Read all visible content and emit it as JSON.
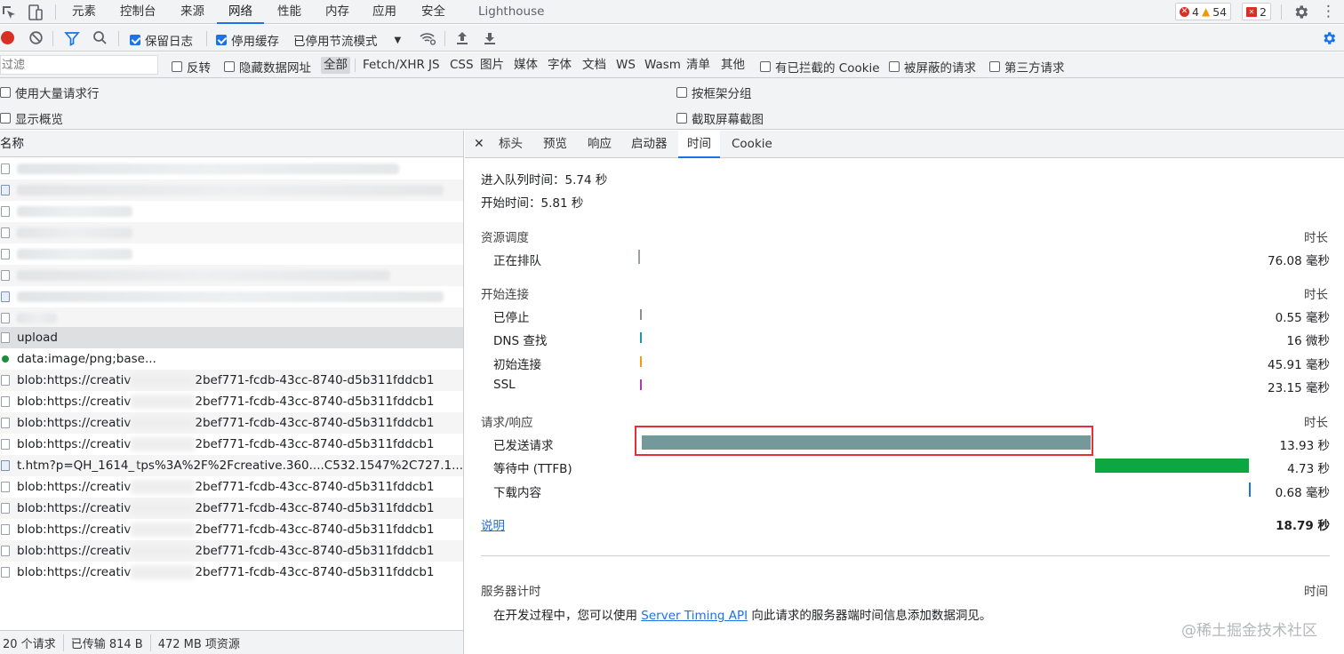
{
  "top_tabs": [
    "元素",
    "控制台",
    "来源",
    "网络",
    "性能",
    "内存",
    "应用",
    "安全",
    "Lighthouse"
  ],
  "active_tab": "网络",
  "badges": {
    "errors": "4",
    "warnings": "54",
    "issues": "2"
  },
  "toolbar": {
    "preserve_log": "保留日志",
    "disable_cache": "停用缓存",
    "throttle": "已停用节流模式"
  },
  "filter": {
    "placeholder": "过滤",
    "invert": "反转",
    "hide_data_urls": "隐藏数据网址",
    "types": [
      "全部",
      "Fetch/XHR",
      "JS",
      "CSS",
      "图片",
      "媒体",
      "字体",
      "文档",
      "WS",
      "Wasm",
      "清单",
      "其他"
    ],
    "selected_type": "全部",
    "blocked_cookies": "有已拦截的 Cookie",
    "blocked_requests": "被屏蔽的请求",
    "third_party": "第三方请求"
  },
  "options": {
    "large_rows": "使用大量请求行",
    "group_by_frame": "按框架分组",
    "show_overview": "显示概览",
    "capture_screenshots": "截取屏幕截图"
  },
  "list": {
    "header": "名称",
    "rows": [
      {
        "name": "upload",
        "selected": true
      },
      {
        "name": "data:image/png;base..."
      },
      {
        "name_start": "blob:https://creativ",
        "name_end": "2bef771-fcdb-43cc-8740-d5b311fddcb1"
      },
      {
        "name_start": "blob:https://creativ",
        "name_end": "2bef771-fcdb-43cc-8740-d5b311fddcb1"
      },
      {
        "name_start": "blob:https://creativ",
        "name_end": "2bef771-fcdb-43cc-8740-d5b311fddcb1"
      },
      {
        "name_start": "blob:https://creativ",
        "name_end": "2bef771-fcdb-43cc-8740-d5b311fddcb1"
      },
      {
        "name_start": "t.htm?p=QH_1614_",
        "name_end": "tps%3A%2F%2Fcreative.360....C532.1547%2C727.1..."
      },
      {
        "name_start": "blob:https://creativ",
        "name_end": "2bef771-fcdb-43cc-8740-d5b311fddcb1"
      },
      {
        "name_start": "blob:https://creativ",
        "name_end": "2bef771-fcdb-43cc-8740-d5b311fddcb1"
      },
      {
        "name_start": "blob:https://creativ",
        "name_end": "2bef771-fcdb-43cc-8740-d5b311fddcb1"
      },
      {
        "name_start": "blob:https://creativ",
        "name_end": "2bef771-fcdb-43cc-8740-d5b311fddcb1"
      },
      {
        "name_start": "blob:https://creativ",
        "name_end": "2bef771-fcdb-43cc-8740-d5b311fddcb1"
      }
    ]
  },
  "status": {
    "requests": "20 个请求",
    "transferred": "已传输 814 B",
    "resources": "472 MB 项资源"
  },
  "detail_tabs": [
    "标头",
    "预览",
    "响应",
    "启动器",
    "时间",
    "Cookie"
  ],
  "active_detail_tab": "时间",
  "timing": {
    "queued_at": "进入队列时间：5.74 秒",
    "started_at": "开始时间：5.81 秒",
    "duration_header": "时长",
    "sections": {
      "scheduling": {
        "title": "资源调度",
        "rows": [
          {
            "label": "正在排队",
            "value": "76.08 毫秒"
          }
        ]
      },
      "connection": {
        "title": "开始连接",
        "rows": [
          {
            "label": "已停止",
            "value": "0.55 毫秒"
          },
          {
            "label": "DNS 查找",
            "value": "16 微秒"
          },
          {
            "label": "初始连接",
            "value": "45.91 毫秒"
          },
          {
            "label": "SSL",
            "value": "23.15 毫秒"
          }
        ]
      },
      "request": {
        "title": "请求/响应",
        "rows": [
          {
            "label": "已发送请求",
            "value": "13.93 秒"
          },
          {
            "label": "等待中 (TTFB)",
            "value": "4.73 秒"
          },
          {
            "label": "下载内容",
            "value": "0.68 毫秒"
          }
        ]
      }
    },
    "explanation": "说明",
    "total": "18.79 秒",
    "server_timing": {
      "title": "服务器计时",
      "time_header": "时间",
      "text_before": "在开发过程中，您可以使用 ",
      "link": "Server Timing API",
      "text_after": " 向此请求的服务器端时间信息添加数据洞见。"
    }
  },
  "watermark": "@稀土掘金技术社区",
  "colors": {
    "accent": "#1a73e8",
    "sent_bar": "#73999a",
    "ttfb_bar": "#0ca740",
    "highlight_box": "#e5303b",
    "record": "#d93025"
  }
}
